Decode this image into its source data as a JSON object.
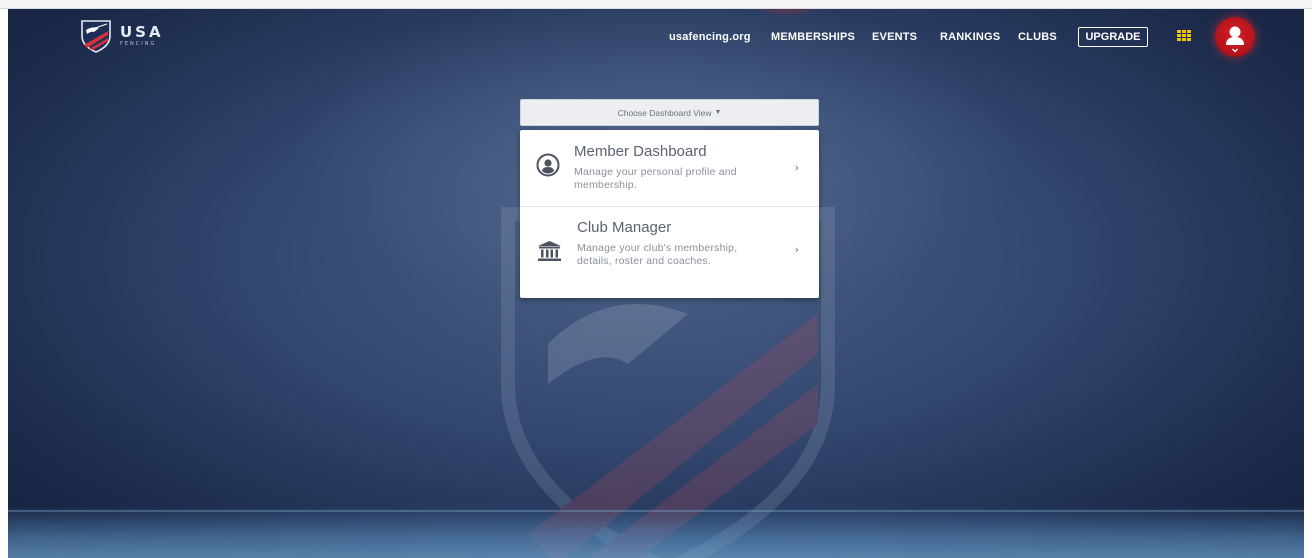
{
  "brand": {
    "logo_text": "USA",
    "logo_subtext": "FENCING"
  },
  "nav": {
    "links": [
      {
        "label": "usafencing.org"
      },
      {
        "label": "MEMBERSHIPS"
      },
      {
        "label": "EVENTS"
      },
      {
        "label": "RANKINGS"
      },
      {
        "label": "CLUBS"
      }
    ],
    "upgrade_label": "UPGRADE",
    "apps_icon": "grid-icon",
    "avatar_icon": "user-avatar-icon"
  },
  "dashboard": {
    "chooser_label": "Choose Dashboard View",
    "options": [
      {
        "title": "Member Dashboard",
        "description": "Manage your personal profile and membership.",
        "icon": "user-circle-icon"
      },
      {
        "title": "Club Manager",
        "description": "Manage your club's membership, details, roster and coaches.",
        "icon": "bank-building-icon"
      }
    ]
  },
  "colors": {
    "background_dark": "#1d2c4d",
    "background_light": "#4a5f86",
    "accent_red": "#d91f26",
    "apps_yellow": "#f4c400",
    "panel_bg": "#ffffff"
  }
}
